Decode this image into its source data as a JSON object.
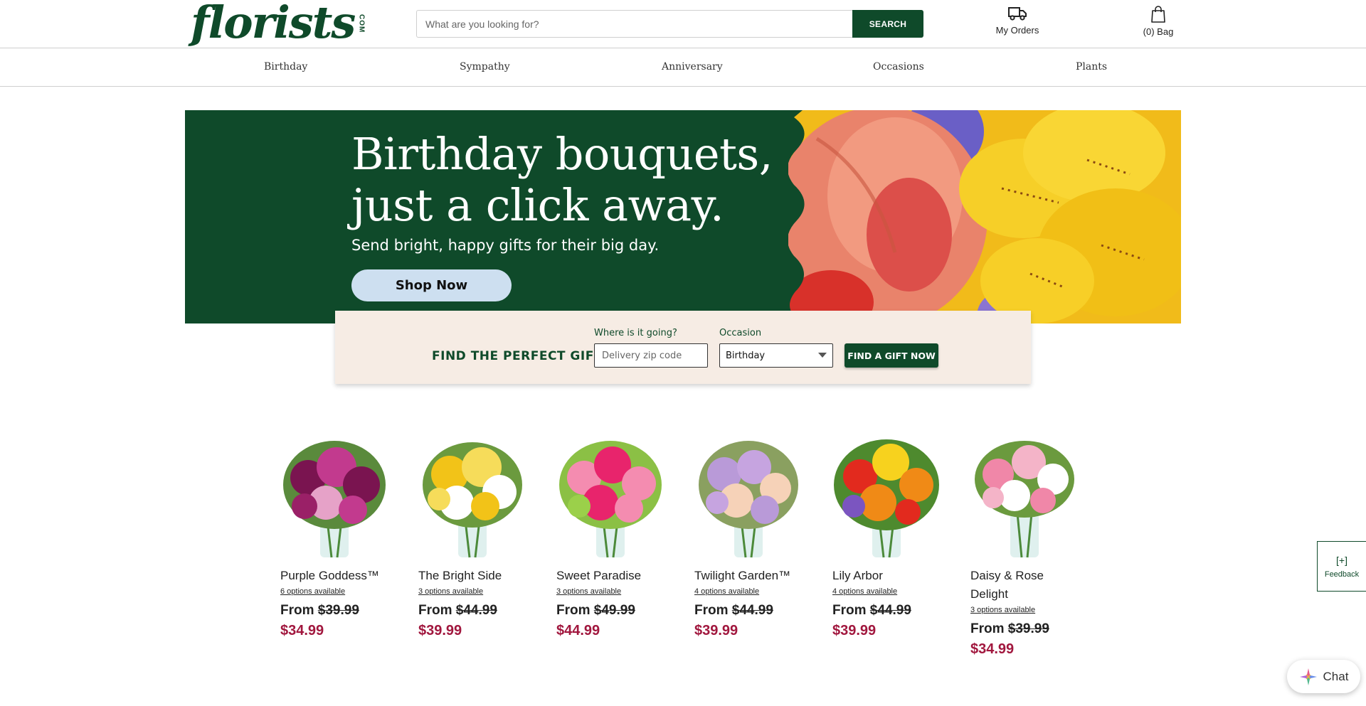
{
  "header": {
    "logo_word": "florists",
    "logo_suffix": "COM",
    "search_placeholder": "What are you looking for?",
    "search_button": "SEARCH",
    "orders_label": "My Orders",
    "bag_label": "(0) Bag"
  },
  "nav": {
    "items": [
      {
        "label": "Birthday"
      },
      {
        "label": "Sympathy"
      },
      {
        "label": "Anniversary"
      },
      {
        "label": "Occasions"
      },
      {
        "label": "Plants"
      }
    ]
  },
  "hero": {
    "title_line1": "Birthday bouquets,",
    "title_line2": "just a click away.",
    "subtitle": "Send bright, happy gifts for their big day.",
    "button": "Shop Now",
    "bg_color": "#0f4a2a"
  },
  "finder": {
    "title": "FIND THE PERFECT GIFT",
    "zip_label": "Where is it going?",
    "zip_placeholder": "Delivery zip code",
    "occasion_label": "Occasion",
    "occasion_value": "Birthday",
    "button": "FIND A GIFT NOW"
  },
  "products": [
    {
      "name": "Purple Goddess™",
      "options": "6 options available",
      "from_label": "From",
      "old_price": "$39.99",
      "price": "$34.99",
      "colors": [
        "#7a1450",
        "#c23a8e",
        "#e6a2c8"
      ]
    },
    {
      "name": "The Bright Side",
      "options": "3 options available",
      "from_label": "From",
      "old_price": "$44.99",
      "price": "$39.99",
      "colors": [
        "#f2c318",
        "#ffffff",
        "#f6dc5a"
      ]
    },
    {
      "name": "Sweet Paradise",
      "options": "3 options available",
      "from_label": "From",
      "old_price": "$49.99",
      "price": "$44.99",
      "colors": [
        "#e8246c",
        "#f48cb0",
        "#9bd04a"
      ]
    },
    {
      "name": "Twilight Garden™",
      "options": "4 options available",
      "from_label": "From",
      "old_price": "$44.99",
      "price": "$39.99",
      "colors": [
        "#b99ad8",
        "#f6d2b8",
        "#c6a4e0"
      ]
    },
    {
      "name": "Lily Arbor",
      "options": "4 options available",
      "from_label": "From",
      "old_price": "$44.99",
      "price": "$39.99",
      "colors": [
        "#f08a16",
        "#e22a1e",
        "#f7d21e"
      ]
    },
    {
      "name": "Daisy & Rose Delight",
      "options": "3 options available",
      "from_label": "From",
      "old_price": "$39.99",
      "price": "$34.99",
      "colors": [
        "#f087a8",
        "#ffffff",
        "#f4b4c8"
      ]
    }
  ],
  "widgets": {
    "feedback_icon": "[+]",
    "feedback_label": "Feedback",
    "chat_label": "Chat"
  },
  "colors": {
    "brand_green": "#0f4a2a",
    "sale_red": "#a1173e",
    "finder_bg": "#f6ece4",
    "hero_button": "#cddff0"
  }
}
